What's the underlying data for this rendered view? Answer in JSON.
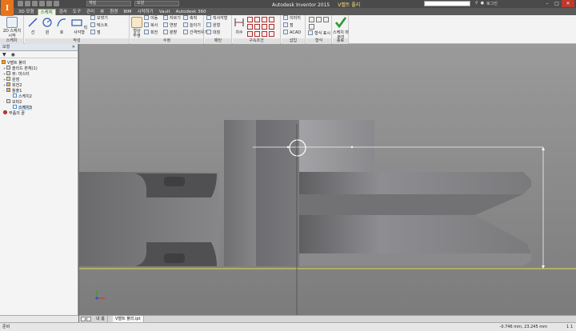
{
  "titlebar": {
    "app_logo": "I",
    "qat_combo_1": "재질",
    "qat_combo_2": "모양",
    "title": "Autodesk Inventor 2015",
    "document": "V벨트 풀리",
    "user": "로그인"
  },
  "tabs": [
    {
      "label": "3D 모형"
    },
    {
      "label": "스케치"
    },
    {
      "label": "검사"
    },
    {
      "label": "도구"
    },
    {
      "label": "관리"
    },
    {
      "label": "뷰"
    },
    {
      "label": "환경"
    },
    {
      "label": "BIM"
    },
    {
      "label": "시작하기"
    },
    {
      "label": "Vault"
    },
    {
      "label": "Autodesk 360"
    }
  ],
  "ribbon": {
    "sketch_panel": {
      "title": "스케치",
      "start_2d": "2D 스케치 시작"
    },
    "create_panel": {
      "title": "작성",
      "line": "선",
      "circle": "원",
      "arc": "호",
      "rectangle": "직사각형",
      "fillet": "모깎기",
      "text": "텍스트",
      "point": "점"
    },
    "modify_panel": {
      "title": "수정",
      "project": "형상 투영",
      "move": "이동",
      "copy": "복사",
      "rotate": "회전",
      "trim": "자르기",
      "extend": "연장",
      "split": "분할",
      "scale": "축척",
      "stretch": "늘이기",
      "offset": "간격띄우기"
    },
    "pattern_panel": {
      "title": "패턴",
      "rect_array": "직사각형",
      "circular": "원형",
      "mirror": "대칭"
    },
    "constrain_panel": {
      "title": "구속조건",
      "dimension": "치수"
    },
    "insert_panel": {
      "title": "삽입",
      "image": "이미지",
      "points": "점",
      "acad": "ACAD"
    },
    "format_panel": {
      "title": "형식",
      "show_format": "형식 표시"
    },
    "finish_panel": {
      "title": "종료",
      "finish_sketch": "스케치 마무리"
    }
  },
  "browser": {
    "header": "모형",
    "items": [
      {
        "label": "V벨트 풀리",
        "type": "part"
      },
      {
        "label": "솔리드 본체(1)",
        "type": "folder"
      },
      {
        "label": "뷰: 마스터",
        "type": "folder"
      },
      {
        "label": "원점",
        "type": "folder"
      },
      {
        "label": "회전2",
        "type": "folder"
      },
      {
        "label": "돌출1",
        "type": "folder"
      },
      {
        "label": "스케치2",
        "type": "sketch"
      },
      {
        "label": "모따2",
        "type": "folder"
      },
      {
        "label": "스케치3",
        "type": "sketch"
      },
      {
        "label": "부품의 끝",
        "type": "end"
      }
    ]
  },
  "doc_tabs": [
    {
      "label": "내 홈"
    },
    {
      "label": "V벨트 풀리.ipt"
    }
  ],
  "status": {
    "left": "준비",
    "coords": "-0.746 mm, 23.245 mm",
    "count": "1",
    "count_suffix": "1"
  }
}
